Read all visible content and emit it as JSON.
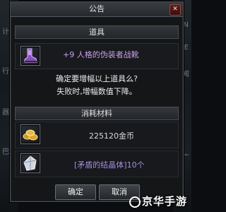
{
  "background": {
    "left_fragments": [
      "计",
      "行",
      "器",
      "巴"
    ],
    "right_fragments": [
      "N",
      "E",
      "闻",
      "广"
    ]
  },
  "dialog": {
    "title": "公告",
    "close_symbol": "✕",
    "item_section": {
      "header": "道具",
      "item_name": "+9 人格的伪装者战靴"
    },
    "confirm_lines": [
      "确定要增幅以上道具么?",
      "失败时,增幅数值下降。"
    ],
    "materials": {
      "header": "消耗材料",
      "gold_label": "225120金币",
      "crystal_label": "[矛盾的结晶体]10个"
    },
    "buttons": {
      "confirm": "确定",
      "cancel": "取消"
    }
  },
  "watermark": "京华手游",
  "colors": {
    "item_name": "#c9a0e8",
    "crystal_label": "#a98ce6",
    "gold_label": "#ececec"
  }
}
